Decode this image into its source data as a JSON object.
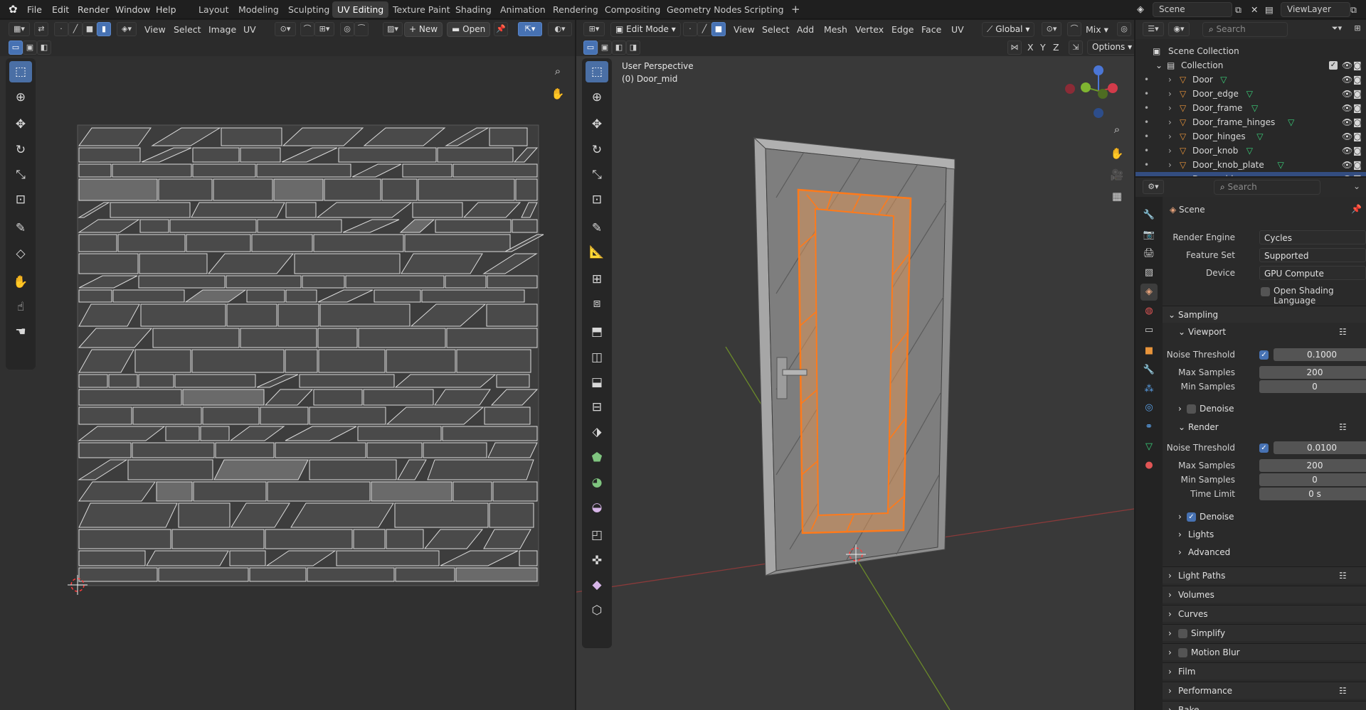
{
  "menubar": {
    "items": [
      "File",
      "Edit",
      "Render",
      "Window",
      "Help"
    ],
    "workspaces": [
      "Layout",
      "Modeling",
      "Sculpting",
      "UV Editing",
      "Texture Paint",
      "Shading",
      "Animation",
      "Rendering",
      "Compositing",
      "Geometry Nodes",
      "Scripting"
    ],
    "active_workspace": "UV Editing",
    "add_label": "+",
    "scene_name": "Scene",
    "view_layer": "ViewLayer"
  },
  "uv_editor": {
    "menus": [
      "View",
      "Select",
      "Image",
      "UV"
    ],
    "new_label": "New",
    "open_label": "Open"
  },
  "viewport": {
    "mode": "Edit Mode",
    "menus": [
      "View",
      "Select",
      "Add",
      "Mesh",
      "Vertex",
      "Edge",
      "Face",
      "UV"
    ],
    "transform_orientation": "Global",
    "shading_mix": "Mix",
    "axes": [
      "X",
      "Y",
      "Z"
    ],
    "options_label": "Options",
    "perspective_label": "User Perspective",
    "object_label": "(0) Door_mid",
    "accent_selection": "#ff7a1a"
  },
  "outliner": {
    "search_placeholder": "Search",
    "scene_collection": "Scene Collection",
    "collection": "Collection",
    "objects": [
      "Door",
      "Door_edge",
      "Door_frame",
      "Door_frame_hinges",
      "Door_hinges",
      "Door_knob",
      "Door_knob_plate",
      "Door_mid"
    ],
    "selected": "Door_mid"
  },
  "properties": {
    "search_placeholder": "Search",
    "context": "Scene",
    "render_engine_label": "Render Engine",
    "render_engine": "Cycles",
    "feature_set_label": "Feature Set",
    "feature_set": "Supported",
    "device_label": "Device",
    "device": "GPU Compute",
    "osl_label": "Open Shading Language",
    "sampling": "Sampling",
    "viewport": "Viewport",
    "noise_threshold_label": "Noise Threshold",
    "vp_noise": "0.1000",
    "max_samples_label": "Max Samples",
    "vp_max": "200",
    "min_samples_label": "Min Samples",
    "vp_min": "0",
    "denoise_label": "Denoise",
    "render": "Render",
    "r_noise": "0.0100",
    "r_max": "200",
    "r_min": "0",
    "time_limit_label": "Time Limit",
    "r_time": "0 s",
    "lights": "Lights",
    "advanced": "Advanced",
    "panels": [
      "Light Paths",
      "Volumes",
      "Curves",
      "Simplify",
      "Motion Blur",
      "Film",
      "Performance",
      "Bake"
    ]
  }
}
